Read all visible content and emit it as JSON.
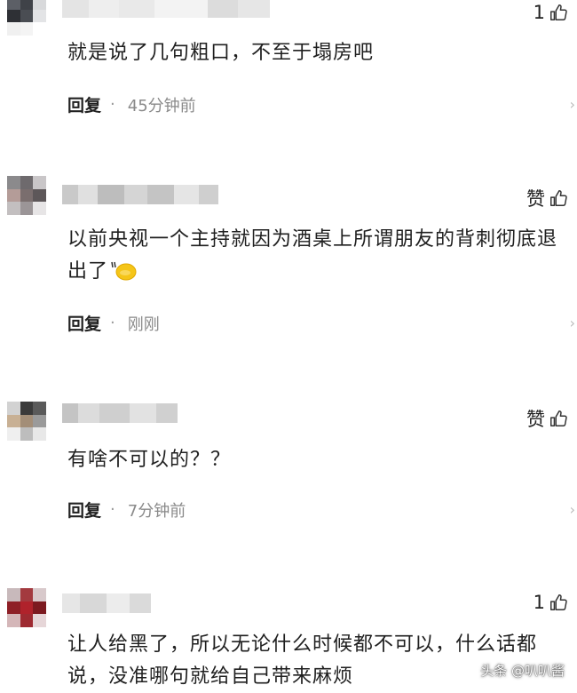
{
  "comments": [
    {
      "likes": "1",
      "text": "就是说了几句粗口，不至于塌房吧",
      "reply_label": "回复",
      "separator": "·",
      "time": "45分钟前"
    },
    {
      "likes": "赞",
      "text": "以前央视一个主持就因为酒桌上所谓朋友的背刺彻底退出了",
      "emoji_icon": "grimace-emoji-icon",
      "reply_label": "回复",
      "separator": "·",
      "time": "刚刚"
    },
    {
      "likes": "赞",
      "text": "有啥不可以的？？",
      "reply_label": "回复",
      "separator": "·",
      "time": "7分钟前"
    },
    {
      "likes": "1",
      "text": "让人给黑了，所以无论什么时候都不可以，什么话都说，没准哪句就给自己带来麻烦"
    }
  ],
  "watermark": "头条 @叭叭酱",
  "colors": {
    "accent_text": "#1f1f1f",
    "meta_text": "#8a8a8a",
    "thumb_stroke": "#333333"
  }
}
